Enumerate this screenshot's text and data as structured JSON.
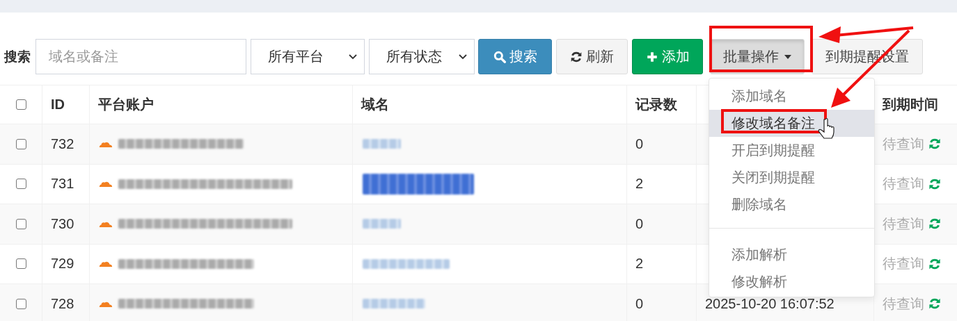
{
  "search": {
    "label": "搜索",
    "placeholder": "域名或备注",
    "platform": "所有平台",
    "status": "所有状态"
  },
  "buttons": [
    {
      "label": "搜索",
      "kind": "search"
    },
    {
      "label": "刷新",
      "kind": "refresh"
    },
    {
      "label": "添加",
      "kind": "add"
    },
    {
      "label": "批量操作",
      "kind": "dropdown",
      "expanded": true
    },
    {
      "label": "到期提醒设置",
      "kind": "plain"
    }
  ],
  "table": {
    "columns": [
      {
        "kind": "checkbox",
        "checked": false
      },
      {
        "kind": "text",
        "label": "ID"
      },
      {
        "kind": "text",
        "label": "平台账户"
      },
      {
        "kind": "text",
        "label": "域名"
      },
      {
        "kind": "text",
        "label": "记录数"
      },
      {
        "kind": "covered"
      },
      {
        "kind": "text",
        "label": "到期时间"
      }
    ],
    "rows": [
      {
        "checked": false,
        "id": "732",
        "domain_highlighted": false,
        "records": "0",
        "expiry": "待查询"
      },
      {
        "checked": false,
        "id": "731",
        "domain_highlighted": true,
        "records": "2",
        "expiry": "待查询"
      },
      {
        "checked": false,
        "id": "730",
        "domain_highlighted": false,
        "records": "0",
        "expiry": "待查询"
      },
      {
        "checked": false,
        "id": "729",
        "domain_highlighted": false,
        "records": "2",
        "expiry": "待查询"
      },
      {
        "checked": false,
        "id": "728",
        "domain_highlighted": false,
        "records": "0",
        "added": "2025-10-20 16:07:52",
        "expiry": "待查询"
      }
    ]
  },
  "menu": {
    "items": [
      {
        "kind": "item",
        "label": "添加域名",
        "hovered": false,
        "marked": false
      },
      {
        "kind": "item",
        "label": "修改域名备注",
        "hovered": true,
        "marked": true
      },
      {
        "kind": "item",
        "label": "开启到期提醒",
        "hovered": false,
        "marked": false
      },
      {
        "kind": "item",
        "label": "关闭到期提醒",
        "hovered": false,
        "marked": false
      },
      {
        "kind": "item",
        "label": "删除域名",
        "hovered": false,
        "marked": false
      },
      {
        "kind": "divider"
      },
      {
        "kind": "item",
        "label": "添加解析",
        "hovered": false,
        "marked": false
      },
      {
        "kind": "item",
        "label": "修改解析",
        "hovered": false,
        "marked": false
      }
    ]
  }
}
